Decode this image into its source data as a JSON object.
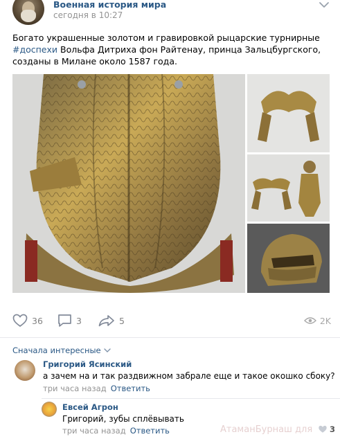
{
  "group": {
    "name": "Военная история мира",
    "time": "сегодня в 10:27"
  },
  "post": {
    "text_before": "Богато украшенные золотом и гравировкой рыцарские турнирные ",
    "hashtag": "#доспехи",
    "text_after": " Вольфа Дитриха фон Райтенау, принца Зальцбургского, созданы в Милане около 1587 года."
  },
  "actions": {
    "likes": "36",
    "comments": "3",
    "shares": "5",
    "views": "2K"
  },
  "comments": {
    "sort_label": "Сначала интересные",
    "items": [
      {
        "author": "Григорий Ясинский",
        "text": "а зачем на и так раздвижном забрале еще и такое окошко сбоку?",
        "time": "три часа назад",
        "reply_label": "Ответить"
      },
      {
        "author": "Евсей Агрон",
        "text": "Григорий, зубы сплёвывать",
        "time": "три часа назад",
        "reply_label": "Ответить"
      }
    ]
  },
  "watermark": "АтаманБурнаш для",
  "reply_likes": "3",
  "colors": {
    "link": "#2a5885",
    "muted": "#939393",
    "divider": "#e7e8ec",
    "gold": "#b08a3a"
  },
  "icons": [
    "heart-icon",
    "comment-icon",
    "share-icon",
    "eye-icon",
    "chevron-down-icon"
  ]
}
